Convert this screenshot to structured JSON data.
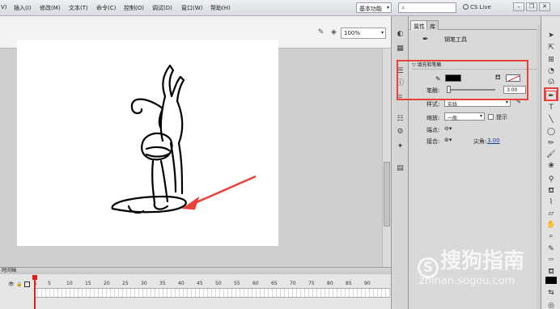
{
  "menubar": {
    "items": [
      "V)",
      "插入(I)",
      "修改(M)",
      "文本(T)",
      "命令(C)",
      "控制(O)",
      "调试(D)",
      "窗口(W)",
      "帮助(H)"
    ],
    "workspace": "基本功能",
    "cs_live": "CS Live"
  },
  "stage": {
    "zoom": "100%"
  },
  "timeline": {
    "title": "时间轴",
    "frames": [
      "1",
      "5",
      "10",
      "15",
      "20",
      "25",
      "30",
      "35",
      "40",
      "45",
      "50",
      "55",
      "60",
      "65",
      "70",
      "75",
      "80",
      "85",
      "90"
    ]
  },
  "properties": {
    "tab_properties": "属性",
    "tab_library": "库",
    "tool_name": "钢笔工具",
    "section_fill_stroke": "填充和笔触",
    "stroke_label": "笔触:",
    "stroke_value": "3.00",
    "style_label": "样式:",
    "style_value": "实线",
    "scale_label": "缩放:",
    "scale_value": "一般",
    "hint_label": "提示",
    "cap_label": "端点:",
    "join_label": "接合:",
    "miter_label": "尖角:",
    "miter_value": "3.00"
  },
  "watermark": {
    "brand": "搜狗指南",
    "url": "zhinan.sogou.com"
  },
  "colors": {
    "highlight": "#e8423b",
    "stroke_color": "#000000"
  }
}
